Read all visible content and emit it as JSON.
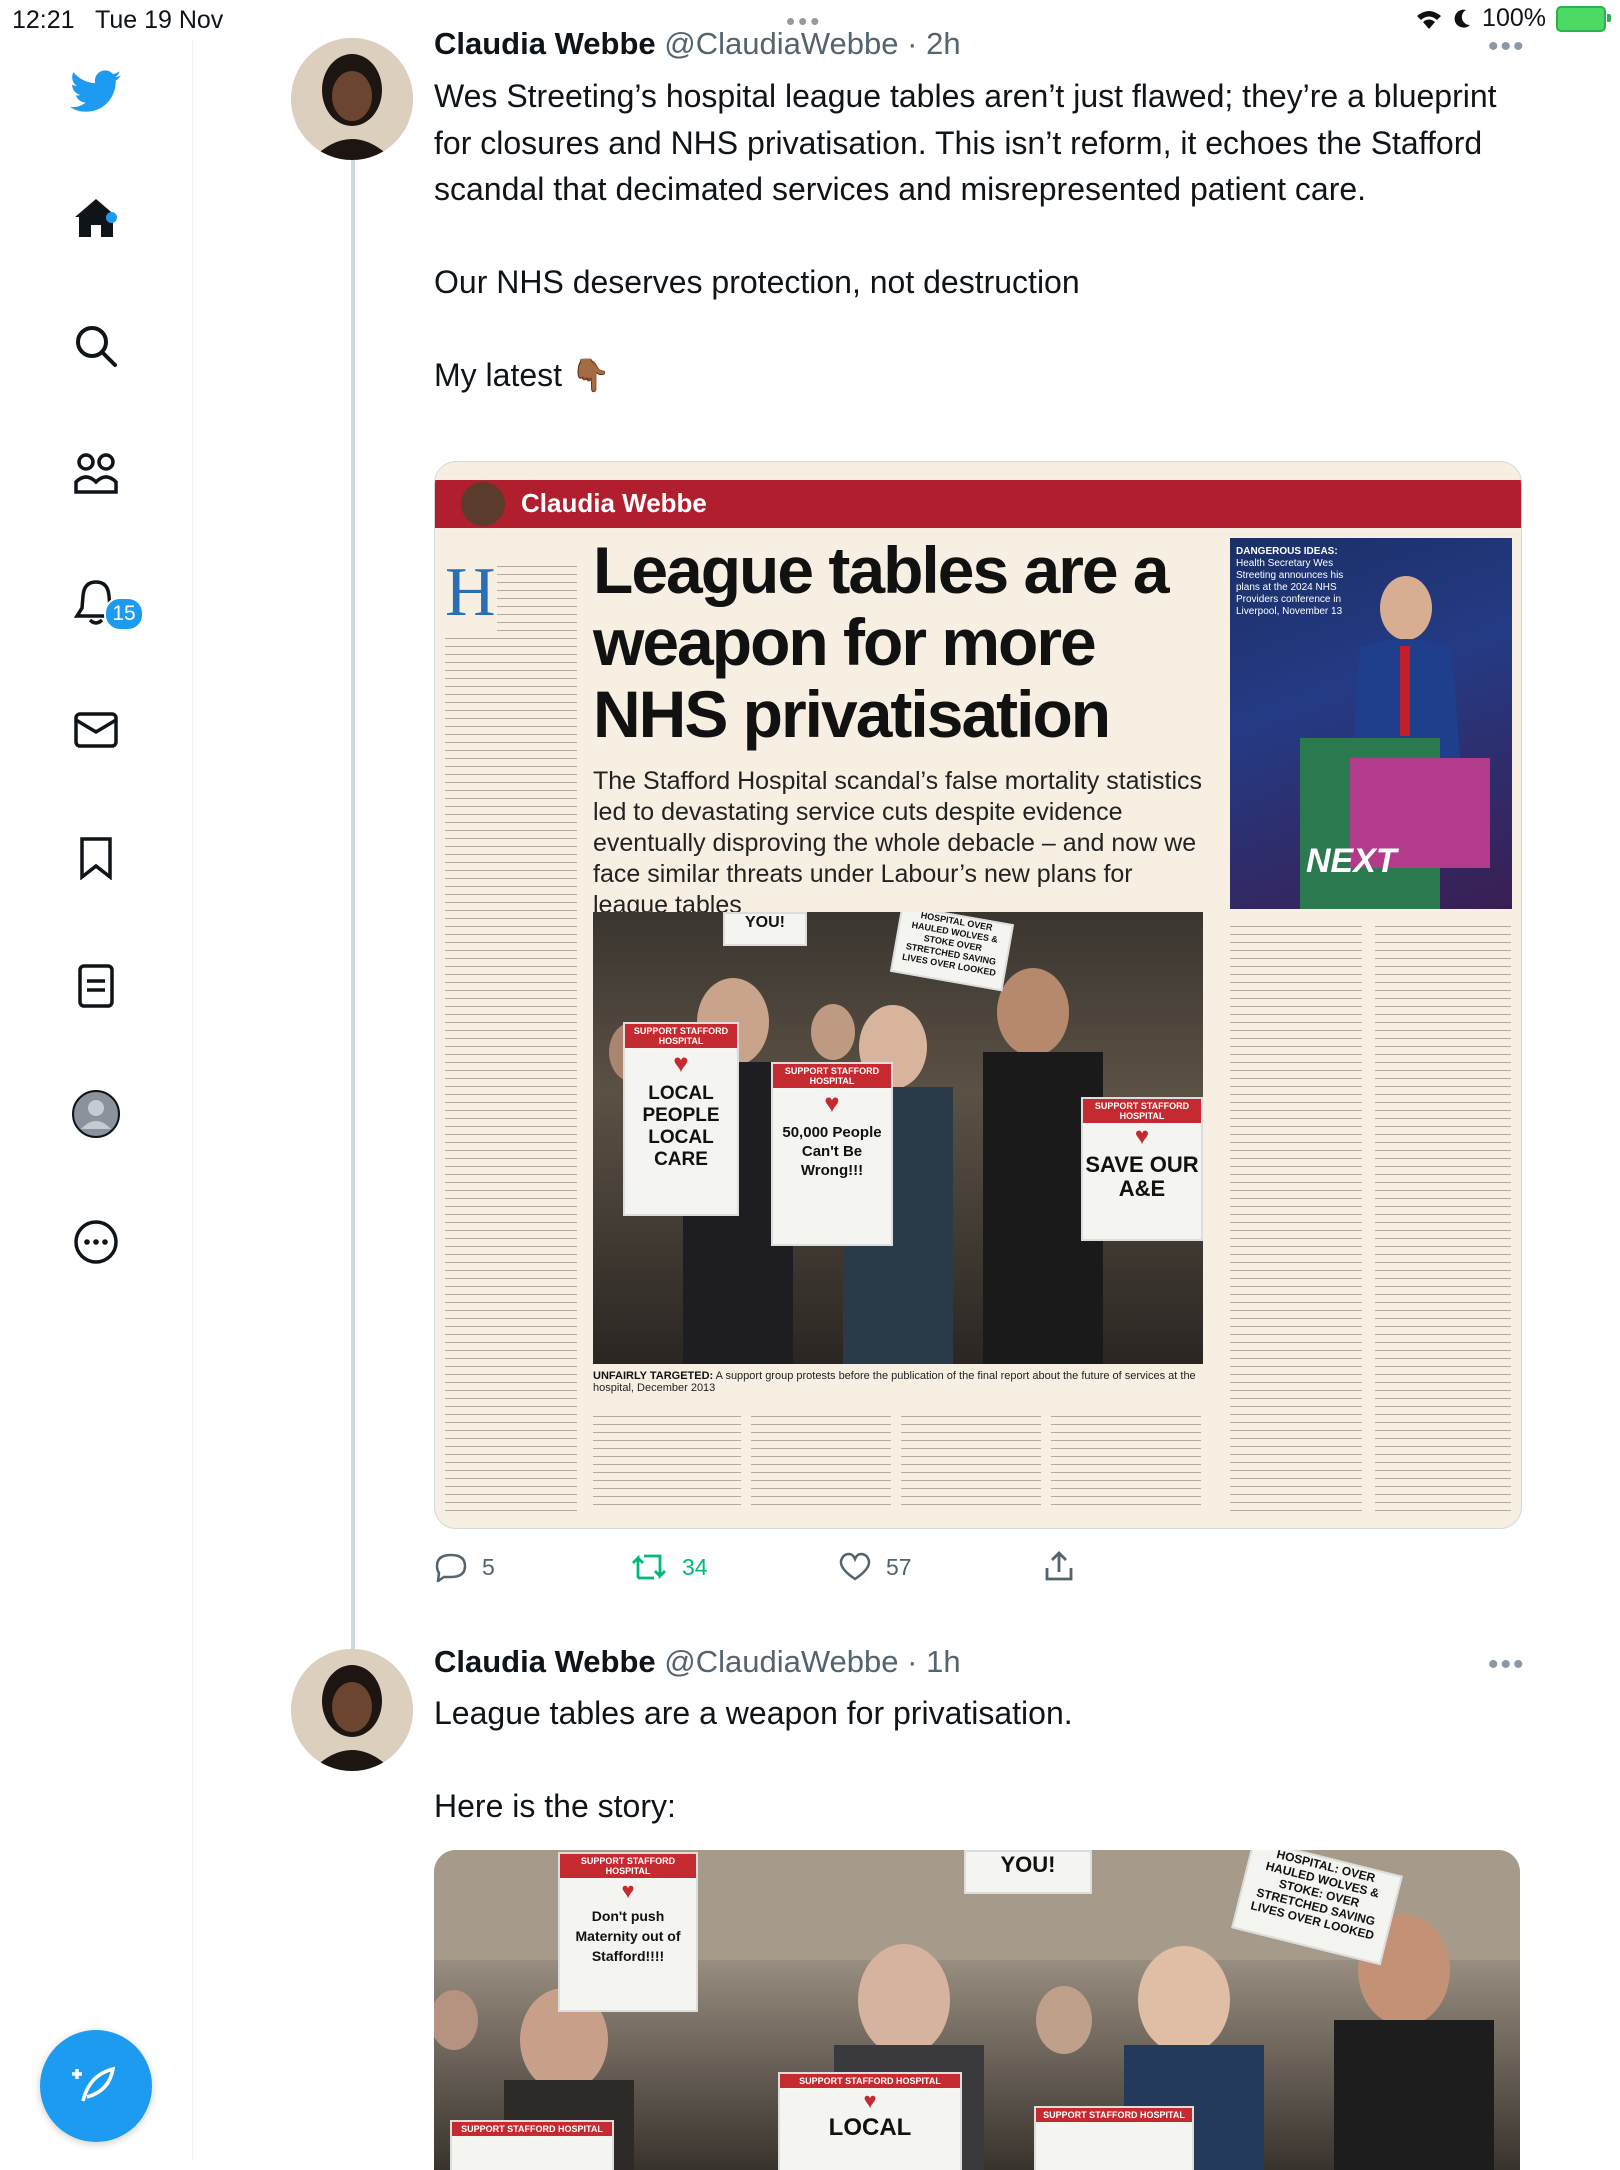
{
  "status_bar": {
    "time": "12:21",
    "date": "Tue 19 Nov",
    "battery": "100%"
  },
  "sidebar": {
    "notifications_count": "15",
    "items": [
      "twitter-logo",
      "home",
      "search",
      "communities",
      "notifications",
      "messages",
      "bookmarks",
      "lists",
      "profile",
      "more"
    ]
  },
  "tweet1": {
    "name": "Claudia Webbe",
    "handle": "@ClaudiaWebbe",
    "time": "· 2h",
    "text": [
      "Wes Streeting’s hospital league tables aren’t just flawed; they’re a blueprint for closures and NHS privatisation. This isn’t reform, it echoes the Stafford scandal that decimated services and misrepresented patient care.",
      "Our NHS deserves protection, not destruction",
      "My latest 👇🏾"
    ],
    "replies": "5",
    "retweets": "34",
    "likes": "57"
  },
  "article": {
    "columnist": "Claudia Webbe",
    "headline": "League tables are a weapon for more NHS privatisation",
    "standfirst": "The Stafford Hospital scandal’s false mortality statistics led to devastating service cuts despite evidence eventually disproving the whole debacle – and now we face similar threats under Labour’s new plans for league tables",
    "caption_label": "UNFAIRLY TARGETED:",
    "caption_text": "A support group protests before the publication of the final report about the future of services at the hospital, December 2013",
    "side_caption_label": "DANGEROUS IDEAS:",
    "side_caption_text": "Health Secretary Wes Streeting announces his plans at the 2024 NHS Providers conference in Liverpool, November 13",
    "placards": {
      "p1_top": "SUPPORT STAFFORD HOSPITAL",
      "p1": "LOCAL PEOPLE LOCAL CARE",
      "p2_top": "SUPPORT STAFFORD HOSPITAL",
      "p2": "50,000 People Can't Be Wrong!!!",
      "p3_top": "SUPPORT STAFFORD HOSPITAL",
      "p3": "SAVE OUR A&E",
      "p4": "YOU!",
      "p5": "HOSPITAL OVER HAULED WOLVES & STOKE OVER STRETCHED SAVING LIVES OVER LOOKED"
    },
    "next_logo": "NEXT"
  },
  "tweet2": {
    "name": "Claudia Webbe",
    "handle": "@ClaudiaWebbe",
    "time": "· 1h",
    "text": [
      "League tables are a weapon for privatisation.",
      "Here is the story:"
    ],
    "placards": {
      "p1_top": "SUPPORT STAFFORD HOSPITAL",
      "p1": "Don't push Maternity out of Stafford!!!!",
      "p2": "YOU!",
      "p3": "HOSPITAL: OVER HAULED WOLVES & STOKE: OVER STRETCHED SAVING LIVES OVER LOOKED",
      "p4_top": "SUPPORT STAFFORD HOSPITAL",
      "p4": "LOCAL",
      "p5_top": "SUPPORT STAFFORD HOSPITAL",
      "p6_top": "SUPPORT STAFFORD HOSPITAL"
    }
  },
  "colors": {
    "accent": "#1d9bf0",
    "retweet": "#00ba7c",
    "paper_band": "#b11f2f"
  }
}
